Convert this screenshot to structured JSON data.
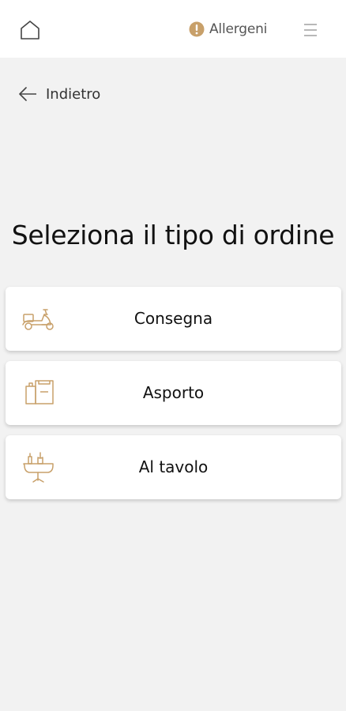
{
  "header": {
    "allergens_label": "Allergeni",
    "icons": {
      "home": "home-icon",
      "allergens": "alert-circle-icon",
      "menu": "hamburger-menu-icon"
    }
  },
  "back": {
    "label": "Indietro",
    "icon": "arrow-left-icon"
  },
  "page": {
    "title": "Seleziona il tipo di ordine"
  },
  "order_types": [
    {
      "label": "Consegna",
      "icon": "scooter-delivery-icon"
    },
    {
      "label": "Asporto",
      "icon": "takeaway-bag-icon"
    },
    {
      "label": "Al tavolo",
      "icon": "dining-table-icon"
    }
  ],
  "colors": {
    "accent": "#c8a06a",
    "background": "#f2f2f2",
    "card": "#ffffff",
    "text": "#111111"
  }
}
